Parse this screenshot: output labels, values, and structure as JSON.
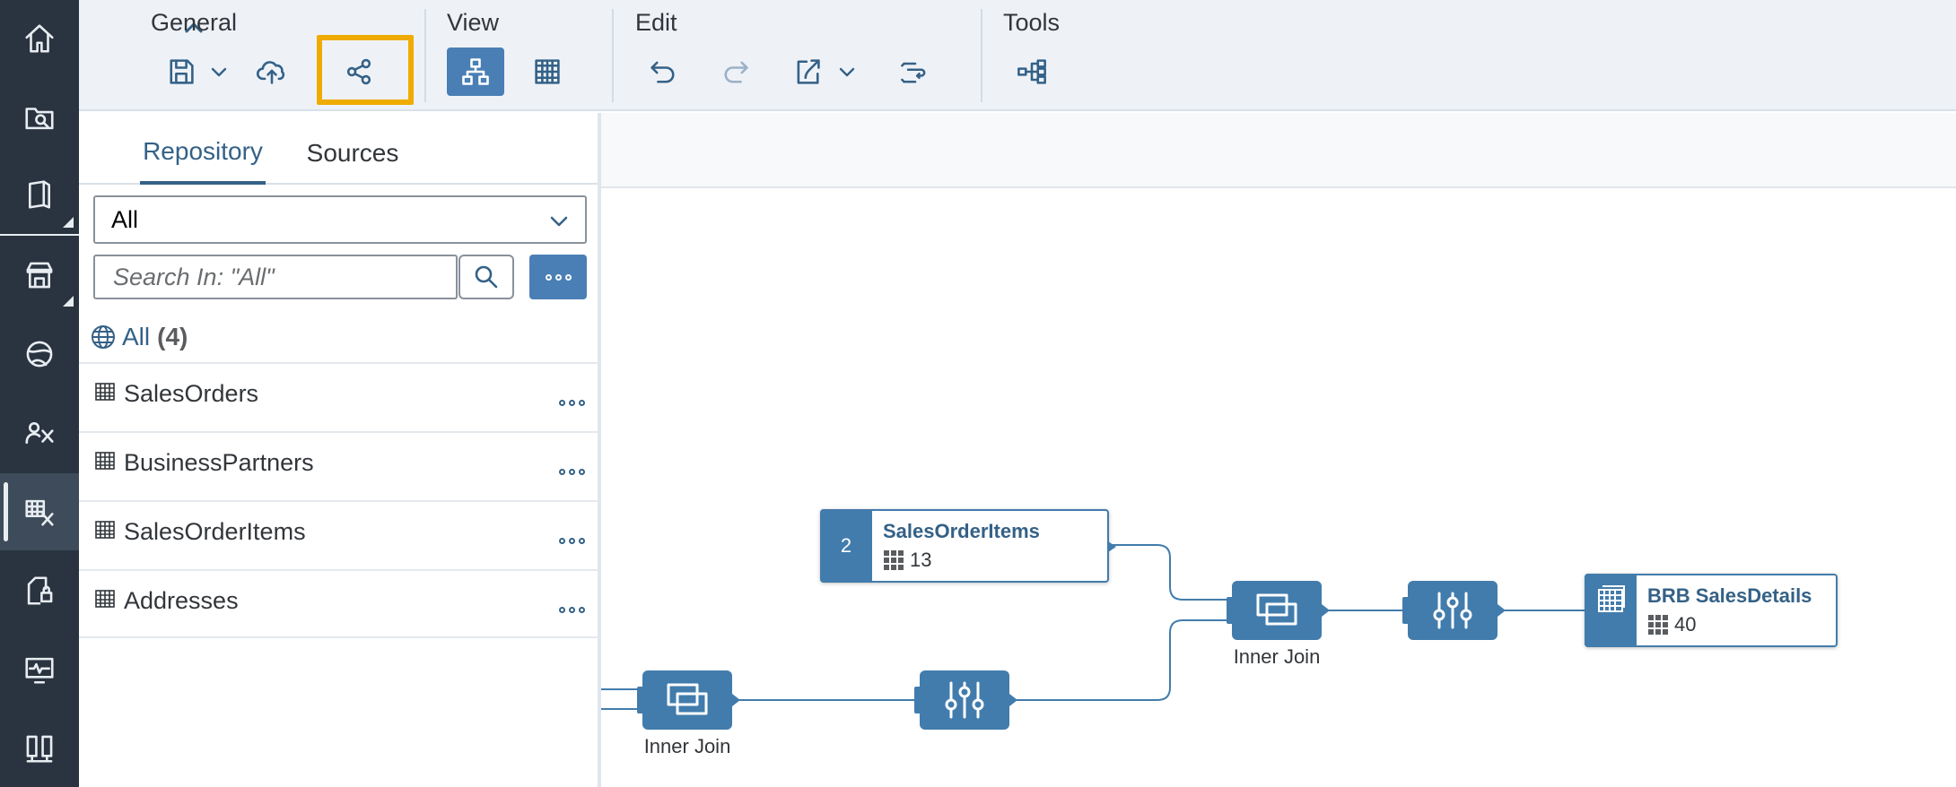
{
  "toolbar": {
    "groups": {
      "general": "General",
      "view": "View",
      "edit": "Edit",
      "tools": "Tools"
    }
  },
  "panel": {
    "tabs": [
      "Repository",
      "Sources"
    ],
    "filter_value": "All",
    "search_placeholder": "Search In: \"All\"",
    "all_label": "All",
    "all_count": "(4)",
    "items": [
      "SalesOrders",
      "BusinessPartners",
      "SalesOrderItems",
      "Addresses"
    ]
  },
  "canvas": {
    "nodes": [
      {
        "badge": "2",
        "title": "SalesOrderItems",
        "count": "13"
      },
      {
        "title": "BRB SalesDetails",
        "count": "40"
      }
    ],
    "join_label": "Inner Join"
  },
  "colors": {
    "accent": "#427cac",
    "highlight": "#f0ab00",
    "nav_bg": "#2a3440"
  }
}
